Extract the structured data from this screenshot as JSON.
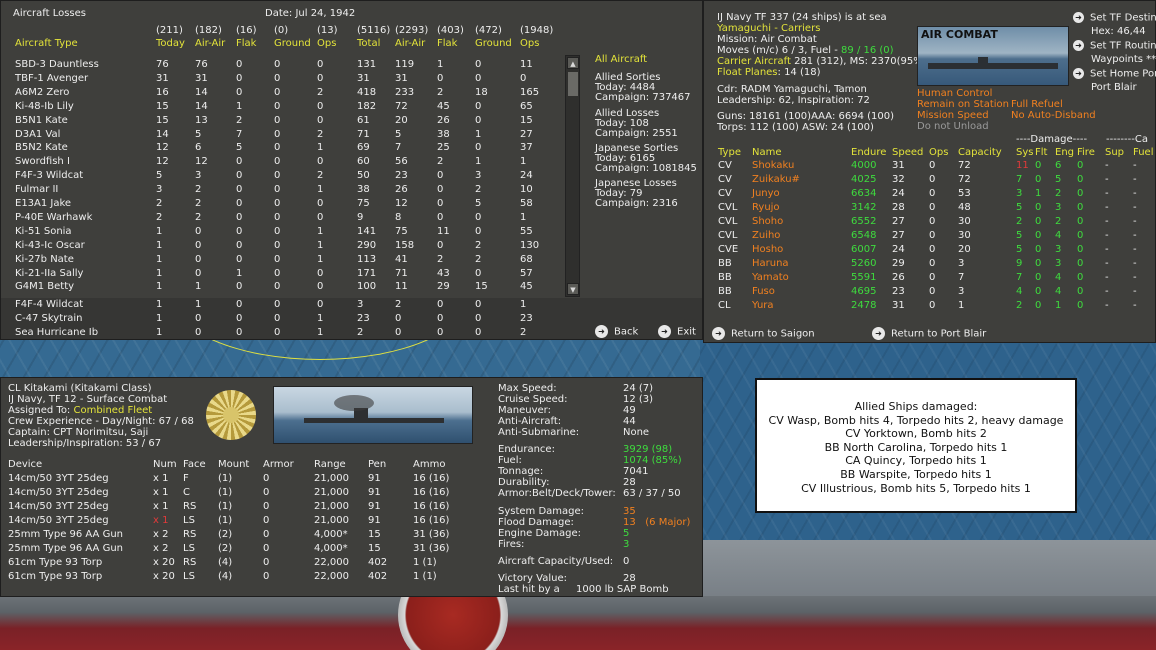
{
  "losses": {
    "title": "Aircraft Losses",
    "date": "Date: Jul 24, 1942",
    "totals": [
      "(211)",
      "(182)",
      "(16)",
      "(0)",
      "(13)",
      "(5116)",
      "(2293)",
      "(403)",
      "(472)",
      "(1948)"
    ],
    "headers": [
      "Aircraft Type",
      "Today",
      "Air-Air",
      "Flak",
      "Ground",
      "Ops",
      "Total",
      "Air-Air",
      "Flak",
      "Ground",
      "Ops"
    ],
    "rows": [
      [
        "SBD-3 Dauntless",
        "76",
        "76",
        "0",
        "0",
        "0",
        "131",
        "119",
        "1",
        "0",
        "11"
      ],
      [
        "TBF-1 Avenger",
        "31",
        "31",
        "0",
        "0",
        "0",
        "31",
        "31",
        "0",
        "0",
        "0"
      ],
      [
        "A6M2 Zero",
        "16",
        "14",
        "0",
        "0",
        "2",
        "418",
        "233",
        "2",
        "18",
        "165"
      ],
      [
        "Ki-48-Ib Lily",
        "15",
        "14",
        "1",
        "0",
        "0",
        "182",
        "72",
        "45",
        "0",
        "65"
      ],
      [
        "B5N1 Kate",
        "15",
        "13",
        "2",
        "0",
        "0",
        "61",
        "20",
        "26",
        "0",
        "15"
      ],
      [
        "D3A1 Val",
        "14",
        "5",
        "7",
        "0",
        "2",
        "71",
        "5",
        "38",
        "1",
        "27"
      ],
      [
        "B5N2 Kate",
        "12",
        "6",
        "5",
        "0",
        "1",
        "69",
        "7",
        "25",
        "0",
        "37"
      ],
      [
        "Swordfish I",
        "12",
        "12",
        "0",
        "0",
        "0",
        "60",
        "56",
        "2",
        "1",
        "1"
      ],
      [
        "F4F-3 Wildcat",
        "5",
        "3",
        "0",
        "0",
        "2",
        "50",
        "23",
        "0",
        "3",
        "24"
      ],
      [
        "Fulmar II",
        "3",
        "2",
        "0",
        "0",
        "1",
        "38",
        "26",
        "0",
        "2",
        "10"
      ],
      [
        "E13A1 Jake",
        "2",
        "2",
        "0",
        "0",
        "0",
        "75",
        "12",
        "0",
        "5",
        "58"
      ],
      [
        "P-40E Warhawk",
        "2",
        "2",
        "0",
        "0",
        "0",
        "9",
        "8",
        "0",
        "0",
        "1"
      ],
      [
        "Ki-51 Sonia",
        "1",
        "0",
        "0",
        "0",
        "1",
        "141",
        "75",
        "11",
        "0",
        "55"
      ],
      [
        "Ki-43-Ic Oscar",
        "1",
        "0",
        "0",
        "0",
        "1",
        "290",
        "158",
        "0",
        "2",
        "130"
      ],
      [
        "Ki-27b Nate",
        "1",
        "0",
        "0",
        "0",
        "1",
        "113",
        "41",
        "2",
        "2",
        "68"
      ],
      [
        "Ki-21-IIa Sally",
        "1",
        "0",
        "1",
        "0",
        "0",
        "171",
        "71",
        "43",
        "0",
        "57"
      ],
      [
        "G4M1 Betty",
        "1",
        "1",
        "0",
        "0",
        "0",
        "100",
        "11",
        "29",
        "15",
        "45"
      ],
      [
        "F4F-4 Wildcat",
        "1",
        "1",
        "0",
        "0",
        "0",
        "3",
        "2",
        "0",
        "0",
        "1"
      ],
      [
        "C-47 Skytrain",
        "1",
        "0",
        "0",
        "0",
        "1",
        "23",
        "0",
        "0",
        "0",
        "23"
      ],
      [
        "Sea Hurricane Ib",
        "1",
        "0",
        "0",
        "0",
        "1",
        "2",
        "0",
        "0",
        "0",
        "2"
      ]
    ],
    "filter": "All Aircraft",
    "allied_sorties": {
      "label": "Allied Sorties",
      "today": "Today:   4484",
      "campaign": "Campaign: 737467"
    },
    "allied_losses": {
      "label": "Allied Losses",
      "today": "Today:   108",
      "campaign": "Campaign: 2551"
    },
    "japanese_sorties": {
      "label": "Japanese Sorties",
      "today": "Today:   6165",
      "campaign": "Campaign: 1081845"
    },
    "japanese_losses": {
      "label": "Japanese Losses",
      "today": "Today:   79",
      "campaign": "Campaign: 2316"
    },
    "back_label": "Back",
    "exit_label": "Exit"
  },
  "tf": {
    "header": "IJ Navy TF 337 (24 ships) is at sea",
    "name": "Yamaguchi - Carriers",
    "mission": "Mission: Air Combat",
    "moves_prefix": "Moves (m/c)  6 / 3, Fuel - ",
    "moves_fuel": "89 / 16 (0)",
    "carrier_label": "Carrier Aircraft",
    "carrier_value": " 281 (312), MS: 2370(95%)",
    "float_label": "Float Planes",
    "float_value": ": 14 (18)",
    "image_caption": "AIR COMBAT",
    "cdr": "Cdr: RADM Yamaguchi, Tamon",
    "leadership": "Leadership: 62, Inspiration: 72",
    "guns": "Guns: 18161 (100)AAA: 6694 (100)",
    "torps": "Torps: 112 (100)   ASW: 24 (100)",
    "human_control": "Human Control",
    "full_refuel": "Full Refuel",
    "remain_station": "Remain on Station",
    "no_auto_disband": "No Auto-Disband",
    "mission_speed": "Mission Speed",
    "do_not_unload": "Do not Unload",
    "damage_header": "----Damage----",
    "cargo_header": "--------Ca",
    "col_headers": [
      "Type",
      "Name",
      "Endure",
      "Speed",
      "Ops",
      "Capacity",
      "Sys",
      "Flt",
      "Eng",
      "Fire",
      "Sup",
      "Fuel"
    ],
    "ships": [
      [
        "CV",
        "Shokaku",
        "4000",
        "31",
        "0",
        "72",
        "11",
        "0",
        "6",
        "0",
        "-",
        "-"
      ],
      [
        "CV",
        "Zuikaku#",
        "4025",
        "32",
        "0",
        "72",
        "7",
        "0",
        "5",
        "0",
        "-",
        "-"
      ],
      [
        "CV",
        "Junyo",
        "6634",
        "24",
        "0",
        "53",
        "3",
        "1",
        "2",
        "0",
        "-",
        "-"
      ],
      [
        "CVL",
        "Ryujo",
        "3142",
        "28",
        "0",
        "48",
        "5",
        "0",
        "3",
        "0",
        "-",
        "-"
      ],
      [
        "CVL",
        "Shoho",
        "6552",
        "27",
        "0",
        "30",
        "2",
        "0",
        "2",
        "0",
        "-",
        "-"
      ],
      [
        "CVL",
        "Zuiho",
        "6548",
        "27",
        "0",
        "30",
        "5",
        "0",
        "4",
        "0",
        "-",
        "-"
      ],
      [
        "CVE",
        "Hosho",
        "6007",
        "24",
        "0",
        "20",
        "5",
        "0",
        "3",
        "0",
        "-",
        "-"
      ],
      [
        "BB",
        "Haruna",
        "5260",
        "29",
        "0",
        "3",
        "9",
        "0",
        "3",
        "0",
        "-",
        "-"
      ],
      [
        "BB",
        "Yamato",
        "5591",
        "26",
        "0",
        "7",
        "7",
        "0",
        "4",
        "0",
        "-",
        "-"
      ],
      [
        "BB",
        "Fuso",
        "4695",
        "23",
        "0",
        "3",
        "4",
        "0",
        "4",
        "0",
        "-",
        "-"
      ],
      [
        "CL",
        "Yura",
        "2478",
        "31",
        "0",
        "1",
        "2",
        "0",
        "1",
        "0",
        "-",
        "-"
      ]
    ],
    "right_menu": [
      "Set TF Destina",
      "Hex: 46,44",
      "Set TF Routing",
      "Waypoints ***",
      "Set Home Port",
      "Port Blair"
    ],
    "return_saigon": "Return to Saigon",
    "return_port_blair": "Return to Port Blair"
  },
  "ship": {
    "name": "CL Kitakami (Kitakami Class)",
    "tf": "IJ Navy, TF 12 - Surface Combat",
    "assigned_label": "Assigned To: ",
    "assigned_value": "Combined Fleet",
    "crew": "Crew Experience - Day/Night: 67 / 68",
    "captain": "Captain: CPT Norimitsu, Saji",
    "leadership": "Leadership/Inspiration: 53 / 67",
    "stats": [
      [
        "Max Speed:",
        "24  (7)"
      ],
      [
        "Cruise Speed:",
        "12  (3)"
      ],
      [
        "Maneuver:",
        "49"
      ],
      [
        "Anti-Aircraft:",
        "44"
      ],
      [
        "Anti-Submarine:",
        "None"
      ]
    ],
    "endurance_label": "Endurance:",
    "endurance_value": "3929  (98)",
    "fuel_label": "Fuel:",
    "fuel_value": "1074  (85%)",
    "tonnage_label": "Tonnage:",
    "tonnage_value": "7041",
    "durability_label": "Durability:",
    "durability_value": "28",
    "armor_label": "Armor:Belt/Deck/Tower:",
    "armor_value": "63 / 37 / 50",
    "sysdmg_label": "System Damage:",
    "sysdmg_value": "35",
    "flood_label": "Flood Damage:",
    "flood_value": "13",
    "flood_major": "(6 Major)",
    "engine_label": "Engine Damage:",
    "engine_value": "5",
    "fires_label": "Fires:",
    "fires_value": "3",
    "aircraft_label": "Aircraft Capacity/Used:",
    "aircraft_value": "0",
    "vp_label": "Victory Value:",
    "vp_value": "28",
    "lasthit_label": "Last hit by a",
    "lasthit_value": "1000 lb SAP Bomb",
    "device_headers": [
      "Device",
      "Num",
      "Face",
      "Mount",
      "Armor",
      "Range",
      "Pen",
      "Ammo"
    ],
    "devices": [
      [
        "14cm/50 3YT 25deg",
        "x 1",
        "F",
        "(1)",
        "0",
        "21,000",
        "91",
        "16  (16)"
      ],
      [
        "14cm/50 3YT 25deg",
        "x 1",
        "C",
        "(1)",
        "0",
        "21,000",
        "91",
        "16  (16)"
      ],
      [
        "14cm/50 3YT 25deg",
        "x 1",
        "RS",
        "(1)",
        "0",
        "21,000",
        "91",
        "16  (16)"
      ],
      [
        "14cm/50 3YT 25deg",
        "x 1",
        "LS",
        "(1)",
        "0",
        "21,000",
        "91",
        "16  (16)"
      ],
      [
        "25mm Type 96 AA Gun",
        "x 2",
        "RS",
        "(2)",
        "0",
        "4,000*",
        "15",
        "31  (36)"
      ],
      [
        "25mm Type 96 AA Gun",
        "x 2",
        "LS",
        "(2)",
        "0",
        "4,000*",
        "15",
        "31  (36)"
      ],
      [
        "61cm Type 93 Torp",
        "x 20",
        "RS",
        "(4)",
        "0",
        "22,000",
        "402",
        "1   (1)"
      ],
      [
        "61cm Type 93 Torp",
        "x 20",
        "LS",
        "(4)",
        "0",
        "22,000",
        "402",
        "1   (1)"
      ]
    ]
  },
  "damaged": {
    "title": "Allied Ships damaged:",
    "lines": [
      "CV Wasp, Bomb hits 4, Torpedo hits 2,  heavy damage",
      "CV Yorktown, Bomb hits 2",
      "BB North Carolina, Torpedo hits 1",
      "CA Quincy, Torpedo hits 1",
      "BB Warspite, Torpedo hits 1",
      "CV Illustrious, Bomb hits 5, Torpedo hits 1"
    ]
  },
  "colors": {
    "highlight_yellow": "#e3e33a",
    "good_green": "#3edc3e",
    "warn_orange": "#f08020",
    "panel": "#3f3f3c"
  }
}
